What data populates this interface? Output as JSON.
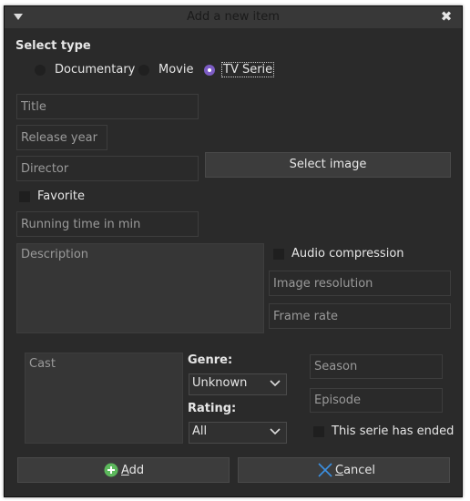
{
  "window": {
    "title": "Add a new item"
  },
  "select_type": {
    "label": "Select type",
    "options": [
      "Documentary",
      "Movie",
      "TV Serie"
    ],
    "selected": "TV Serie"
  },
  "fields": {
    "title_placeholder": "Title",
    "release_year_placeholder": "Release year",
    "director_placeholder": "Director",
    "running_time_placeholder": "Running time in min",
    "description_placeholder": "Description",
    "image_resolution_placeholder": "Image resolution",
    "frame_rate_placeholder": "Frame rate",
    "cast_placeholder": "Cast",
    "season_placeholder": "Season",
    "episode_placeholder": "Episode"
  },
  "buttons": {
    "select_image": "Select image",
    "add": "Add",
    "add_mnemonic": "A",
    "add_rest": "dd",
    "cancel": "Cancel",
    "cancel_mnemonic": "C",
    "cancel_rest": "ancel"
  },
  "checkboxes": {
    "favorite": {
      "label": "Favorite",
      "checked": false
    },
    "audio_compression": {
      "label": "Audio compression",
      "checked": false
    },
    "serie_ended": {
      "label": "This serie has ended",
      "checked": false
    }
  },
  "genre": {
    "label": "Genre:",
    "value": "Unknown"
  },
  "rating": {
    "label": "Rating:",
    "value": "All"
  },
  "colors": {
    "accent": "#7c5cc4",
    "background": "#2a2a2a",
    "add_icon": "#5cb85c",
    "cancel_icon": "#3b8fe0"
  },
  "icons": {
    "menu": "triangle-down-icon",
    "close": "close-icon",
    "add": "plus-circle-icon",
    "cancel": "cross-icon",
    "dropdown": "chevron-down-icon"
  }
}
